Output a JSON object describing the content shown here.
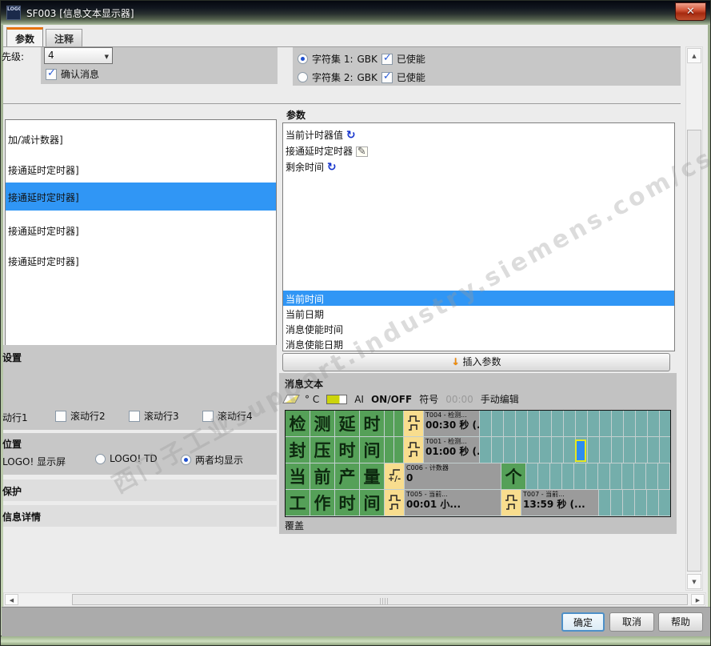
{
  "window": {
    "title": "SF003 [信息文本显示器]",
    "icon_text": "LOGO",
    "close_glyph": "✕"
  },
  "tabs": {
    "parameters": "参数",
    "comments": "注释"
  },
  "top": {
    "priority_label": "先级:",
    "priority_value": "4",
    "ack_label": "确认消息",
    "charsets": [
      {
        "label": "字符集 1:",
        "value": "GBK",
        "enable_label": "已使能"
      },
      {
        "label": "字符集 2:",
        "value": "GBK",
        "enable_label": "已使能"
      }
    ]
  },
  "left_list": {
    "items": [
      {
        "label": "加/减计数器]"
      },
      {
        "label": "接通延时定时器]"
      },
      {
        "label": "接通延时定时器]"
      },
      {
        "label": "接通延时定时器]"
      },
      {
        "label": "接通延时定时器]"
      }
    ],
    "selected_index": 2
  },
  "params": {
    "title": "参数",
    "upper_items": [
      {
        "label": "当前计时器值",
        "icon": "refresh"
      },
      {
        "label": "接通延时定时器",
        "icon": "edit"
      },
      {
        "label": "剩余时间",
        "icon": "refresh"
      }
    ],
    "lower_items": [
      {
        "label": "当前时间"
      },
      {
        "label": "当前日期"
      },
      {
        "label": "消息使能时间"
      },
      {
        "label": "消息使能日期"
      }
    ],
    "selected_lower": "当前时间",
    "insert_button": "插入参数",
    "insert_arrow": "↓"
  },
  "message_text": {
    "title": "消息文本",
    "toolbar": {
      "degree": "° C",
      "ai": "AI",
      "onoff": "ON/OFF",
      "symbol": "符号",
      "time": "00:00",
      "manual": "手动编辑"
    },
    "grid": {
      "rows": [
        {
          "chars": [
            "检",
            "测",
            "延",
            "时"
          ],
          "blocks": [
            {
              "kind": "timer",
              "name": "T004 - 检测...",
              "value": "00:30 秒 (..."
            }
          ]
        },
        {
          "chars": [
            "封",
            "压",
            "时",
            "间"
          ],
          "blocks": [
            {
              "kind": "timer",
              "name": "T001 - 检测...",
              "value": "01:00 秒 (..."
            }
          ]
        },
        {
          "chars": [
            "当",
            "前",
            "产",
            "量"
          ],
          "blocks": [
            {
              "kind": "counter",
              "sign": "+/-",
              "name": "C006 - 计数器",
              "value": "0"
            }
          ],
          "unit": "个"
        },
        {
          "chars": [
            "工",
            "作",
            "时",
            "间"
          ],
          "blocks": [
            {
              "kind": "timer",
              "name": "T005 - 当前...",
              "value": "00:01 小..."
            },
            {
              "kind": "timer",
              "name": "T007 - 当前...",
              "value": "13:59 秒 (..."
            }
          ]
        }
      ]
    },
    "overwrite_label": "覆盖"
  },
  "settings": {
    "title": "设置",
    "scroll_rows": [
      {
        "label": "动行1",
        "checked": false,
        "checkbox_visible": false
      },
      {
        "label": "滚动行2",
        "checked": false,
        "checkbox_visible": true
      },
      {
        "label": "滚动行3",
        "checked": false,
        "checkbox_visible": true
      },
      {
        "label": "滚动行4",
        "checked": false,
        "checkbox_visible": true
      }
    ]
  },
  "position": {
    "title": "位置",
    "options": [
      {
        "label": "LOGO! 显示屏",
        "selected": false,
        "radio_visible": false
      },
      {
        "label": "LOGO! TD",
        "selected": false,
        "radio_visible": true
      },
      {
        "label": "两者均显示",
        "selected": true,
        "radio_visible": true
      }
    ]
  },
  "protection_label": "保护",
  "details_label": "信息详情",
  "footer": {
    "ok": "确定",
    "cancel": "取消",
    "help": "帮助"
  },
  "watermark": {
    "line": "西门子工业support.industry.siemens.com/cs 技术论坛"
  }
}
